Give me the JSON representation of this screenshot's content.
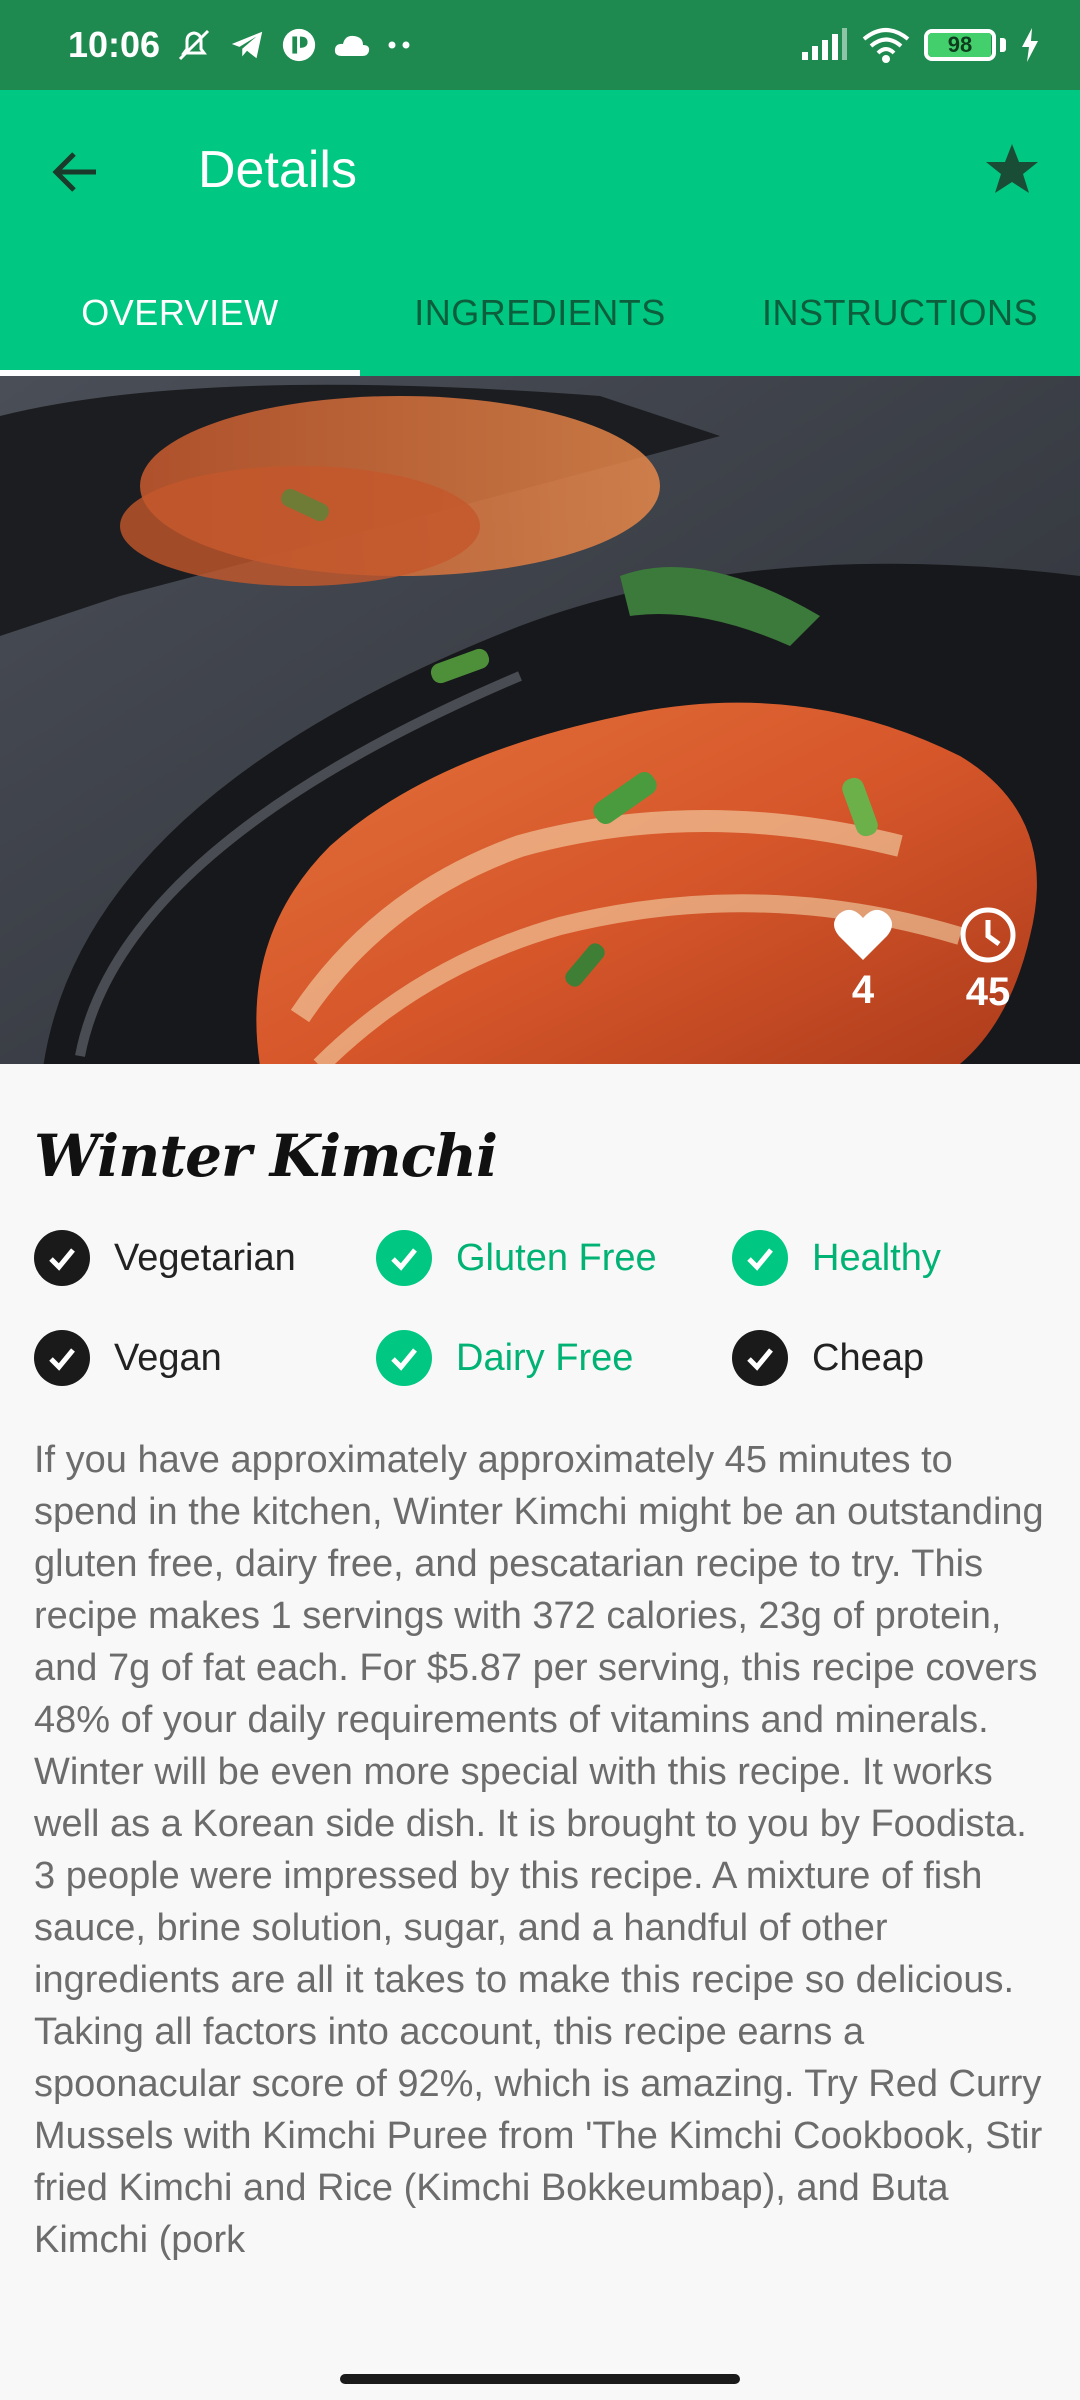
{
  "status_bar": {
    "time": "10:06",
    "battery": "98",
    "battery_level": 0.98,
    "icons": [
      "mute-icon",
      "telegram-icon",
      "app-icon",
      "cloud-icon",
      "more-dots-icon",
      "signal-icon",
      "wifi-icon",
      "battery-icon",
      "charging-icon"
    ]
  },
  "app_bar": {
    "title": "Details",
    "back_icon": "arrow-back-icon",
    "favorite_icon": "star-icon"
  },
  "tabs": [
    {
      "label": "OVERVIEW",
      "active": true
    },
    {
      "label": "INGREDIENTS",
      "active": false
    },
    {
      "label": "INSTRUCTIONS",
      "active": false
    }
  ],
  "hero": {
    "likes": "4",
    "minutes": "45",
    "likes_icon": "heart-icon",
    "time_icon": "clock-icon"
  },
  "recipe": {
    "title": "Winter Kimchi",
    "tags": [
      {
        "label": "Vegetarian",
        "active": false
      },
      {
        "label": "Gluten Free",
        "active": true
      },
      {
        "label": "Healthy",
        "active": true
      },
      {
        "label": "Vegan",
        "active": false
      },
      {
        "label": "Dairy Free",
        "active": true
      },
      {
        "label": "Cheap",
        "active": false
      }
    ],
    "summary": "If you have approximately approximately 45 minutes to spend in the kitchen, Winter Kimchi might be an outstanding gluten free, dairy free, and pescatarian recipe to try. This recipe makes 1 servings with 372 calories, 23g of protein, and 7g of fat each. For $5.87 per serving, this recipe covers 48% of your daily requirements of vitamins and minerals. Winter will be even more special with this recipe. It works well as a Korean side dish. It is brought to you by Foodista. 3 people were impressed by this recipe. A mixture of fish sauce, brine solution, sugar, and a handful of other ingredients are all it takes to make this recipe so delicious. Taking all factors into account, this recipe earns a spoonacular score of 92%, which is amazing. Try Red Curry Mussels with Kimchi Puree from 'The Kimchi Cookbook, Stir fried Kimchi and Rice (Kimchi Bokkeumbap), and Buta Kimchi (pork"
  },
  "colors": {
    "primary": "#00c781",
    "status_bar": "#1f8a4f",
    "tab_inactive": "#0d5e3c",
    "tag_active": "#00c781",
    "tag_inactive": "#1a1a1a",
    "summary_text": "#6c6c6c"
  }
}
